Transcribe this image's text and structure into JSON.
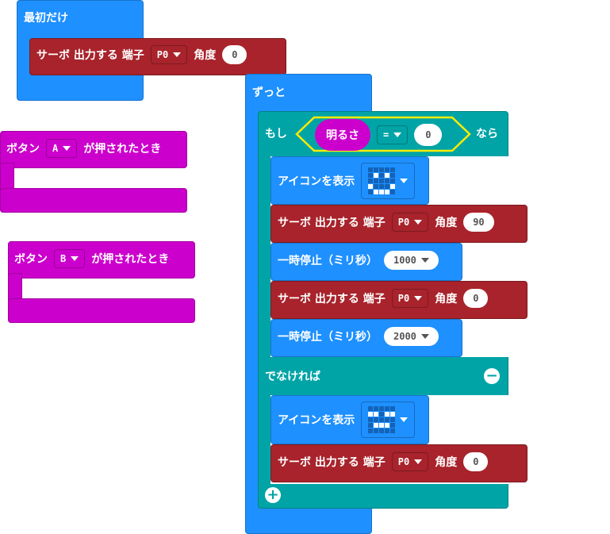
{
  "on_start": {
    "label": "最初だけ",
    "servo": {
      "label": "サーボ 出力する 端子",
      "pin": "P0",
      "angle_label": "角度",
      "angle": "0"
    }
  },
  "button_a": {
    "prefix": "ボタン",
    "button": "A",
    "suffix": "が押されたとき"
  },
  "button_b": {
    "prefix": "ボタン",
    "button": "B",
    "suffix": "が押されたとき"
  },
  "forever": {
    "label": "ずっと",
    "if": {
      "label": "もし",
      "sensor": "明るさ",
      "op": "=",
      "value": "0",
      "then": "なら",
      "else": "でなければ"
    },
    "then_blocks": [
      {
        "type": "icon",
        "label": "アイコンを表示",
        "icon": [
          [
            0,
            0,
            0,
            0,
            0
          ],
          [
            0,
            1,
            0,
            1,
            0
          ],
          [
            0,
            0,
            0,
            0,
            0
          ],
          [
            1,
            0,
            0,
            0,
            1
          ],
          [
            0,
            1,
            1,
            1,
            0
          ]
        ]
      },
      {
        "type": "servo",
        "label": "サーボ 出力する 端子",
        "pin": "P0",
        "angle_label": "角度",
        "angle": "90"
      },
      {
        "type": "pause",
        "label": "一時停止（ミリ秒）",
        "value": "1000"
      },
      {
        "type": "servo",
        "label": "サーボ 出力する 端子",
        "pin": "P0",
        "angle_label": "角度",
        "angle": "0"
      },
      {
        "type": "pause",
        "label": "一時停止（ミリ秒）",
        "value": "2000"
      }
    ],
    "else_blocks": [
      {
        "type": "icon",
        "label": "アイコンを表示",
        "icon": [
          [
            0,
            0,
            0,
            0,
            0
          ],
          [
            1,
            1,
            0,
            1,
            1
          ],
          [
            0,
            0,
            0,
            0,
            0
          ],
          [
            0,
            1,
            1,
            1,
            0
          ],
          [
            0,
            0,
            0,
            0,
            0
          ]
        ]
      },
      {
        "type": "servo",
        "label": "サーボ 出力する 端子",
        "pin": "P0",
        "angle_label": "角度",
        "angle": "0"
      }
    ]
  },
  "colors": {
    "basic": "#1e90ff",
    "servo": "#a8232b",
    "input": "#cc00cc",
    "logic": "#00a4a6"
  }
}
